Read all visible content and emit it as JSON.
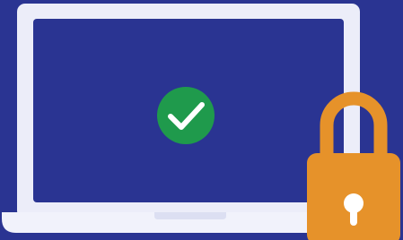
{
  "illustration": {
    "icons": [
      "laptop-icon",
      "checkmark-icon",
      "padlock-icon",
      "keyhole-icon"
    ],
    "colors": {
      "background": "#2a3492",
      "laptop_frame": "#ecedf9",
      "laptop_screen": "#2a3492",
      "laptop_base": "#f1f2fb",
      "base_notch": "#dcdff2",
      "check_circle": "#1f9a4c",
      "check_mark": "#ffffff",
      "lock_body": "#e6922a",
      "lock_shackle": "#e6922a",
      "keyhole": "#ffffff"
    }
  }
}
